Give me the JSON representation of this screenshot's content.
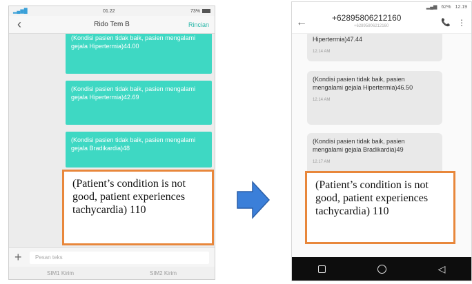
{
  "left_phone": {
    "status": {
      "time": "01.22",
      "battery": "73%"
    },
    "header": {
      "back_icon": "‹",
      "title": "Rido Tem B",
      "detail_link": "Rincian"
    },
    "messages": [
      {
        "text": "(Kondisi pasien tidak baik, pasien mengalami gejala Hipertermia)44.00"
      },
      {
        "text": "(Kondisi pasien tidak baik, pasien mengalami gejala Hipertermia)42.69"
      },
      {
        "text": "(Kondisi pasien tidak baik, pasien mengalami gejala Bradikardia)48"
      }
    ],
    "compose": {
      "plus_icon": "+",
      "placeholder": "Pesan teks"
    },
    "sim_bar": {
      "sim1": "SIM1 Kirim",
      "sim2": "SIM2 Kirim"
    }
  },
  "right_phone": {
    "status": {
      "battery": "62%",
      "time": "12.19"
    },
    "header": {
      "back_icon": "←",
      "phone_number": "+62895806212160",
      "phone_sub": "+62895806212160",
      "call_icon": "📞",
      "more_icon": "⋮"
    },
    "messages": [
      {
        "text": "Hipertermia)47.44",
        "time": "12.14 AM"
      },
      {
        "text": "(Kondisi pasien tidak baik, pasien mengalami gejala Hipertermia)46.50",
        "time": "12.14 AM"
      },
      {
        "text": "(Kondisi pasien tidak baik, pasien mengalami gejala Bradikardia)49",
        "time": "12.17 AM"
      }
    ],
    "navbar": {
      "back_icon": "◁"
    }
  },
  "callouts": {
    "left": "(Patient’s condition is not good, patient experiences tachycardia) 110",
    "right": "(Patient’s condition is not good, patient experiences tachycardia) 110"
  },
  "colors": {
    "accent_teal": "#3ed8c3",
    "callout_border": "#e8873b",
    "arrow_blue": "#3b7fd9"
  }
}
